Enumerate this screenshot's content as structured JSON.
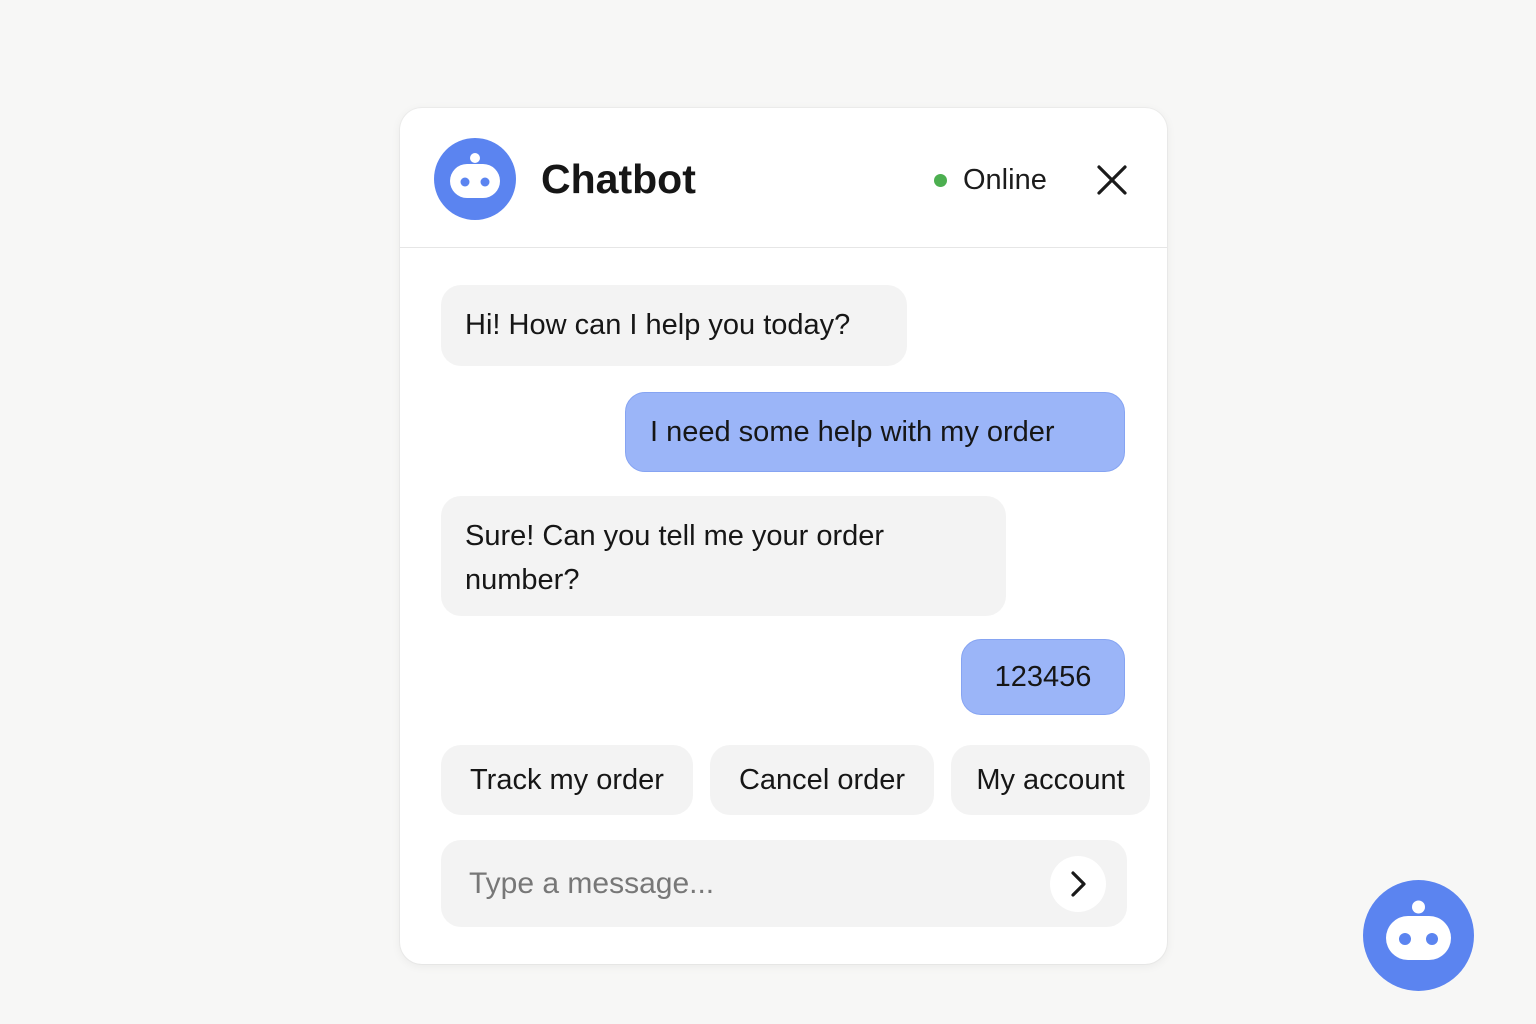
{
  "header": {
    "title": "Chatbot",
    "status": "Online",
    "avatar_icon": "robot-icon",
    "close_icon": "close-icon",
    "status_color": "#4caf50"
  },
  "messages": [
    {
      "sender": "bot",
      "text": "Hi! How can I help you today?"
    },
    {
      "sender": "user",
      "text": "I need some help with my order"
    },
    {
      "sender": "bot",
      "text": "Sure! Can you tell me your order number?"
    },
    {
      "sender": "user",
      "text": "123456"
    }
  ],
  "quick_replies": [
    "Track my order",
    "Cancel order",
    "My account"
  ],
  "composer": {
    "placeholder": "Type a message...",
    "value": "",
    "send_icon": "chevron-right-icon"
  },
  "launcher": {
    "icon": "robot-icon"
  },
  "colors": {
    "accent": "#5b84f0",
    "user_bubble": "#9bb5f8",
    "bot_bubble": "#f3f3f3",
    "background": "#f7f7f6"
  }
}
